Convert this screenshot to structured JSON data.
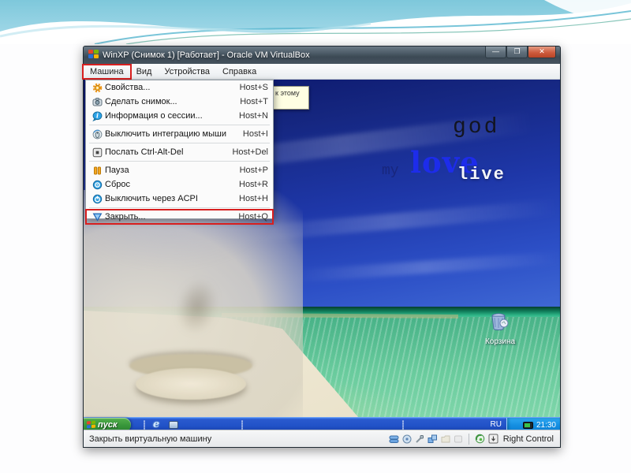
{
  "vbox": {
    "title": "WinXP (Снимок 1) [Работает] - Oracle VM VirtualBox",
    "window_buttons": {
      "minimize": "—",
      "maximize": "❐",
      "close": "✕"
    },
    "menubar": {
      "items": [
        {
          "label": "Машина",
          "highlighted": true
        },
        {
          "label": "Вид",
          "highlighted": false
        },
        {
          "label": "Устройства",
          "highlighted": false
        },
        {
          "label": "Справка",
          "highlighted": false
        }
      ]
    },
    "machine_menu": {
      "items": [
        {
          "icon": "gear-icon",
          "label": "Свойства...",
          "shortcut": "Host+S"
        },
        {
          "icon": "camera-icon",
          "label": "Сделать снимок...",
          "shortcut": "Host+T"
        },
        {
          "icon": "session-info-icon",
          "label": "Информация о сессии...",
          "shortcut": "Host+N"
        },
        {
          "icon": "mouse-integration-icon",
          "label": "Выключить интеграцию мыши",
          "shortcut": "Host+I"
        },
        {
          "icon": "ctrl-alt-del-icon",
          "label": "Послать Ctrl-Alt-Del",
          "shortcut": "Host+Del"
        },
        {
          "icon": "pause-icon",
          "label": "Пауза",
          "shortcut": "Host+P"
        },
        {
          "icon": "reset-icon",
          "label": "Сброс",
          "shortcut": "Host+R"
        },
        {
          "icon": "acpi-icon",
          "label": "Выключить через ACPI",
          "shortcut": "Host+H"
        },
        {
          "icon": "close-vm-icon",
          "label": "Закрыть...",
          "shortcut": "Host+Q",
          "highlighted": true
        }
      ]
    },
    "tooltip_text": "к этому",
    "statusbar": {
      "status_text": "Закрыть виртуальную машину",
      "host_key": "Right Control"
    }
  },
  "guest": {
    "wallpaper_words": {
      "god": "god",
      "love": "love",
      "live": "live",
      "my": "my"
    },
    "desktop_icon": {
      "label": "Корзина"
    },
    "taskbar": {
      "start": "пуск",
      "language": "RU",
      "clock": "21:30"
    }
  },
  "colors": {
    "highlight_red": "#d81f1f",
    "taskbar_blue": "#2a5ace",
    "start_green": "#37953a",
    "tray_blue": "#1690e2",
    "sky_blue": "#1e37a8",
    "water_green": "#69cb9d"
  }
}
